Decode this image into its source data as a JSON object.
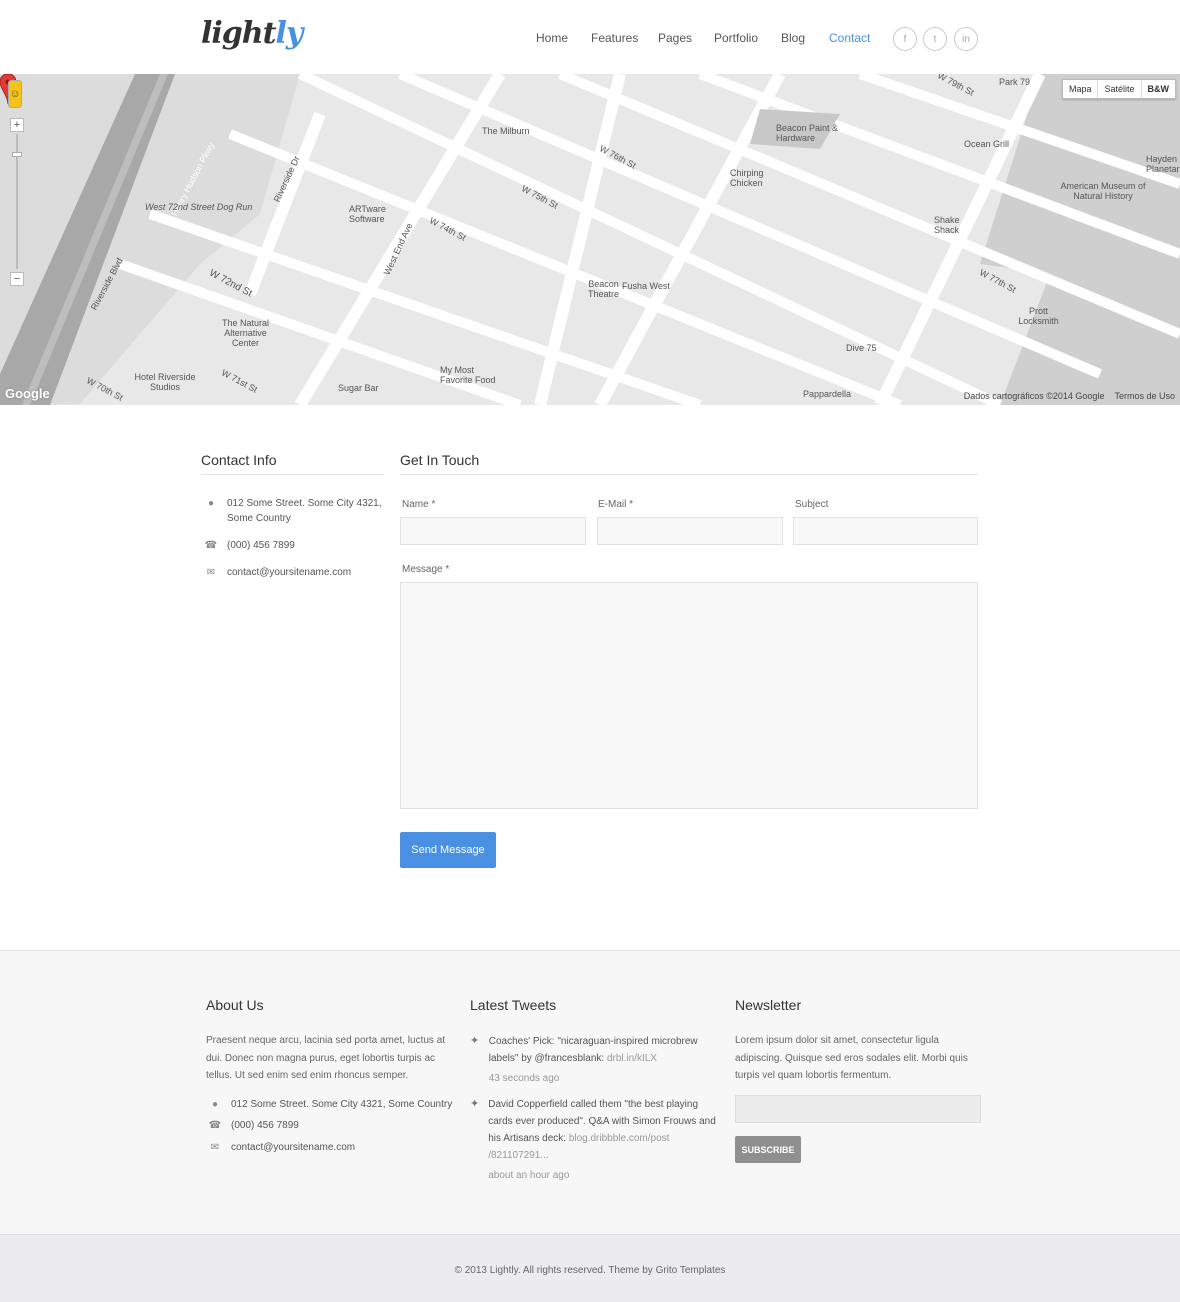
{
  "header": {
    "logo_main": "light",
    "logo_accent": "ly",
    "nav": [
      "Home",
      "Features",
      "Pages",
      "Portfolio",
      "Blog",
      "Contact"
    ],
    "active_nav": "Contact",
    "social": [
      "f",
      "t",
      "in"
    ]
  },
  "map": {
    "type_buttons": [
      "Mapa",
      "Satélite",
      "B&W"
    ],
    "attribution": "Dados cartográficos ©2014 Google",
    "terms": "Termos de Uso",
    "google": "Google",
    "labels": [
      "Henry Hudson Pkwy",
      "West 72nd Street Dog Run",
      "Riverside Dr",
      "ARTware Software",
      "West End Ave",
      "The Milburn",
      "W 75th St",
      "W 74th St",
      "W 76th St",
      "Chirping Chicken",
      "Beacon Paint & Hardware",
      "Ocean Grill",
      "Park 79",
      "American Museum of Natural History",
      "Hayden Planetarium",
      "Shake Shack",
      "W 77th St",
      "Prott Locksmith",
      "Dive 75",
      "Pappardella",
      "Beacon Theatre",
      "Fusha West",
      "My Most Favorite Food",
      "Sugar Bar",
      "The Natural Alternative Center",
      "Hotel Riverside Studios",
      "W 72nd St",
      "W 71st St",
      "W 70th St",
      "Riverside Blvd",
      "W 79th St"
    ]
  },
  "contact_info": {
    "title": "Contact Info",
    "address_line1": "012 Some Street. Some City 4321,",
    "address_line2": "Some Country",
    "phone": "(000) 456 7899",
    "email": "contact@yoursitename.com"
  },
  "form": {
    "title": "Get In Touch",
    "name_label": "Name *",
    "email_label": "E-Mail *",
    "subject_label": "Subject",
    "message_label": "Message *",
    "send_label": "Send Message"
  },
  "footer": {
    "about": {
      "title": "About Us",
      "text": "Praesent neque arcu, lacinia sed porta amet, luctus at dui. Donec non magna purus, eget lobortis turpis ac tellus. Ut sed enim sed enim rhoncus semper.",
      "address": "012 Some Street. Some City 4321, Some Country",
      "phone": "(000) 456 7899",
      "email": "contact@yoursitename.com"
    },
    "tweets": {
      "title": "Latest Tweets",
      "t1_text": "Coaches' Pick: \"nicaraguan-inspired microbrew labels\" by @francesblank: ",
      "t1_link": "drbl.in/kILX",
      "t1_time": "43 seconds ago",
      "t2_text": "David Copperfield called them \"the best playing cards ever produced\". Q&A with Simon Frouws and his Artisans deck: ",
      "t2_link": "blog.dribbble.com/post /821107291...",
      "t2_time": "about an hour ago"
    },
    "newsletter": {
      "title": "Newsletter",
      "text": "Lorem ipsum dolor sit amet, consectetur ligula adipiscing. Quisque sed eros sodales elit. Morbi quis turpis vel quam lobortis fermentum.",
      "subscribe_label": "SUBSCRIBE"
    }
  },
  "copyright": "© 2013 Lightly. All rights reserved. Theme by Grito Templates"
}
